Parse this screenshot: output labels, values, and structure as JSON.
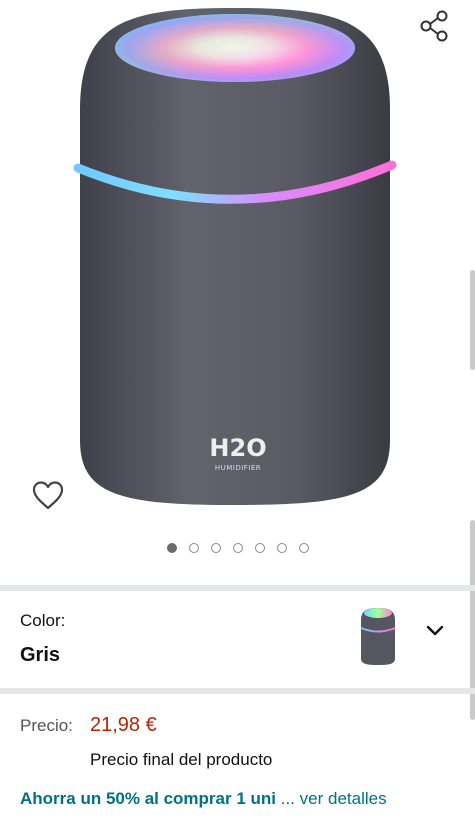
{
  "gallery": {
    "product_mark": "H2O",
    "product_sub": "HUMIDIFIER",
    "total_images": 7,
    "active_index": 0
  },
  "icons": {
    "share": "share-icon",
    "favorite": "heart-outline-icon",
    "dropdown": "chevron-down-icon"
  },
  "variant": {
    "label": "Color:",
    "value": "Gris"
  },
  "price": {
    "label": "Precio:",
    "value": "21,98 €",
    "note": "Precio final del producto"
  },
  "offer": {
    "text": "Ahorra un 50% al comprar 1 uni",
    "ellipsis": "...",
    "link": "ver detalles"
  },
  "colors": {
    "price": "#B12704",
    "link": "#007185",
    "device_body": "#5b5c66"
  }
}
